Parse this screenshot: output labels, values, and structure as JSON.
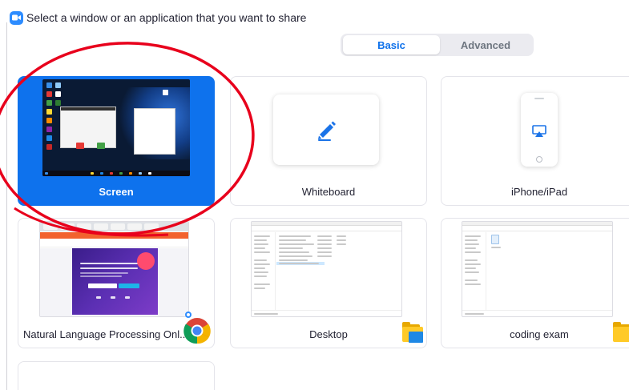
{
  "header": {
    "title": "Select a window or an application that you want to share"
  },
  "tabs": {
    "basic": "Basic",
    "advanced": "Advanced"
  },
  "tiles": {
    "screen": "Screen",
    "whiteboard": "Whiteboard",
    "iphone": "iPhone/iPad",
    "chrome": "Natural Language Processing Onl...",
    "desktop": "Desktop",
    "coding": "coding exam"
  },
  "colors": {
    "accent": "#0e72ed",
    "zoom_logo": "#2d8cff",
    "annotation": "#e8001c"
  },
  "icons": {
    "app_logo": "zoom-logo-icon",
    "whiteboard": "pen-icon",
    "iphone": "airplay-icon",
    "chrome": "chrome-icon",
    "folder": "folder-icon"
  }
}
